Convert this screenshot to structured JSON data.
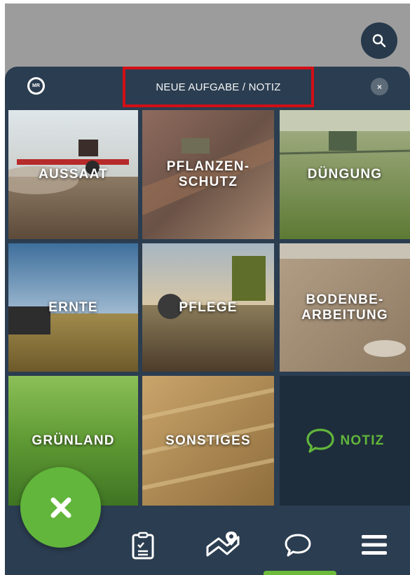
{
  "header": {
    "logo_text": "MR",
    "title": "NEUE AUFGABE / NOTIZ",
    "close_label": "×"
  },
  "tiles": [
    {
      "label": "AUSSAAT"
    },
    {
      "label": "PFLANZEN-\nSCHUTZ"
    },
    {
      "label": "DÜNGUNG"
    },
    {
      "label": "ERNTE"
    },
    {
      "label": "PFLEGE"
    },
    {
      "label": "BODENBE-\nARBEITUNG"
    },
    {
      "label": "GRÜNLAND"
    },
    {
      "label": "SONSTIGES"
    },
    {
      "label": "NOTIZ"
    }
  ],
  "icons": {
    "search": "search-icon",
    "close": "close-icon",
    "notiz": "speech-bubble-icon",
    "tasks": "clipboard-list-icon",
    "map": "map-pin-icon",
    "chat": "chat-bubble-icon",
    "menu": "hamburger-menu-icon"
  },
  "colors": {
    "panel": "#2b3d50",
    "accent_green": "#61b63b",
    "highlight_red": "#d10f16",
    "overlay_gray": "#9c9c9c"
  }
}
